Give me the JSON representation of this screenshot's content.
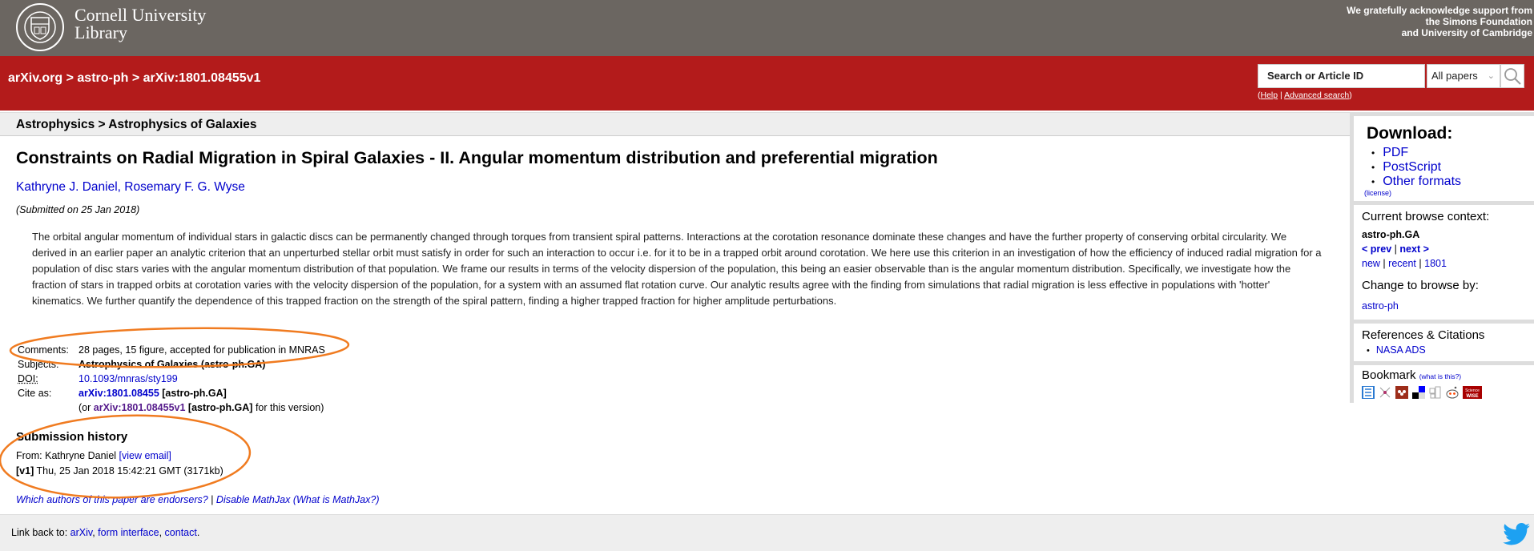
{
  "header": {
    "institution_line1": "Cornell University",
    "institution_line2": "Library",
    "support_line1": "We gratefully acknowledge support from",
    "support_line2": "the Simons Foundation",
    "support_line3": "and University of Cambridge"
  },
  "navbar": {
    "breadcrumb": [
      "arXiv.org",
      "astro-ph",
      "arXiv:1801.08455v1"
    ],
    "breadcrumb_sep": " > ",
    "search_placeholder": "Search or Article ID",
    "search_scope": "All papers",
    "help_label": "Help",
    "advanced_search_label": "Advanced search"
  },
  "subheader": "Astrophysics > Astrophysics of Galaxies",
  "paper": {
    "title": "Constraints on Radial Migration in Spiral Galaxies - II. Angular momentum distribution and preferential migration",
    "authors": "Kathryne J. Daniel, Rosemary F. G. Wyse",
    "submitted": "(Submitted on 25 Jan 2018)",
    "abstract": "The orbital angular momentum of individual stars in galactic discs can be permanently changed through torques from transient spiral patterns. Interactions at the corotation resonance dominate these changes and have the further property of conserving orbital circularity. We derived in an earlier paper an analytic criterion that an unperturbed stellar orbit must satisfy in order for such an interaction to occur i.e. for it to be in a trapped orbit around corotation. We here use this criterion in an investigation of how the efficiency of induced radial migration for a population of disc stars varies with the angular momentum distribution of that population. We frame our results in terms of the velocity dispersion of the population, this being an easier observable than is the angular momentum distribution. Specifically, we investigate how the fraction of stars in trapped orbits at corotation varies with the velocity dispersion of the population, for a system with an assumed flat rotation curve. Our analytic results agree with the finding from simulations that radial migration is less effective in populations with 'hotter' kinematics. We further quantify the dependence of this trapped fraction on the strength of the spiral pattern, finding a higher trapped fraction for higher amplitude perturbations.",
    "metadata": {
      "comments_label": "Comments:",
      "comments": "28 pages, 15 figure, accepted for publication in MNRAS",
      "subjects_label": "Subjects:",
      "subjects": "Astrophysics of Galaxies (astro-ph.GA)",
      "doi_label": "DOI:",
      "doi": "10.1093/mnras/sty199",
      "cite_label": "Cite as:",
      "cite_id": "arXiv:1801.08455",
      "cite_cat": " [astro-ph.GA]",
      "cite_alt_prefix": "(or ",
      "cite_alt_id": "arXiv:1801.08455v1",
      "cite_alt_cat": " [astro-ph.GA]",
      "cite_alt_suffix": " for this version)"
    },
    "history": {
      "title": "Submission history",
      "from_prefix": "From: Kathryne Daniel ",
      "view_email": "[view email]",
      "version_tag": "[v1]",
      "version_detail": " Thu, 25 Jan 2018 15:42:21 GMT (3171kb)"
    },
    "endorsers_link": "Which authors of this paper are endorsers?",
    "separator": " | ",
    "disable_mathjax": "Disable MathJax",
    "what_is_mathjax": "(What is MathJax?)"
  },
  "sidebar": {
    "download_title": "Download:",
    "download_items": [
      "PDF",
      "PostScript",
      "Other formats"
    ],
    "license": "(license)",
    "browse_context_title": "Current browse context:",
    "browse_context": "astro-ph.GA",
    "prev": "< prev",
    "next": "next >",
    "new": "new",
    "recent": "recent",
    "month": "1801",
    "change_browse_title": "Change to browse by:",
    "change_browse_link": "astro-ph",
    "refs_title": "References & Citations",
    "refs_items": [
      "NASA ADS"
    ],
    "bookmark_title": "Bookmark",
    "bookmark_help": "(what is this?)",
    "bookmark_icons": [
      "bibsonomy-icon",
      "citeulike-icon",
      "mendeley-icon",
      "delicious-icon",
      "connotea-icon",
      "reddit-icon",
      "sciencewise-icon"
    ]
  },
  "footer": {
    "prefix": "Link back to: ",
    "links": [
      "arXiv",
      "form interface",
      "contact"
    ]
  },
  "colors": {
    "cornell_gray": "#6b6661",
    "arxiv_red": "#b31b1b",
    "link_blue": "#0000cc",
    "annotation_orange": "#f07b20",
    "twitter_blue": "#1da1f2"
  }
}
